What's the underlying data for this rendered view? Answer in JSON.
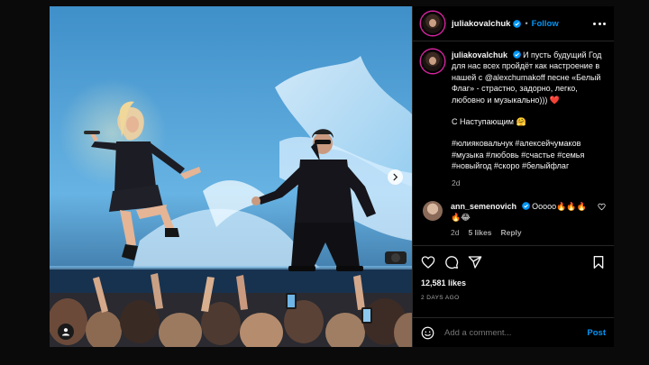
{
  "post": {
    "username": "juliakovalchuk",
    "follow_label": "Follow",
    "separator": "•",
    "caption": {
      "username": "juliakovalchuk",
      "text": "И пусть будущий Год для нас всех пройдёт как настроение в нашей с @alexchumakoff песне «Белый Флаг» - страстно, задорно, легко, любовно и музыкально)))",
      "text_emoji": "❤️",
      "greeting": "С Наступающим 🤗",
      "hashtags": "#юлияковальчук #алексейчумаков #музыка #любовь #счастье #семья #новыйгод #скоро #белыйфлаг",
      "time": "2d"
    },
    "comments": [
      {
        "username": "ann_semenovich",
        "text": "Ооооо🔥🔥🔥🔥😂",
        "time": "2d",
        "likes": "5 likes",
        "reply": "Reply"
      }
    ],
    "likes": "12,581 likes",
    "date": "2 DAYS AGO",
    "add_comment_placeholder": "Add a comment...",
    "post_label": "Post"
  },
  "colors": {
    "accent": "#0095f6",
    "background": "#000000",
    "border": "#262626",
    "muted": "#a8a8a8",
    "heart": "#ed4956"
  },
  "icons": [
    "chevron-right-icon",
    "user-tag-icon",
    "verified-badge-icon",
    "more-options-icon",
    "heart-icon",
    "comment-icon",
    "share-icon",
    "bookmark-icon",
    "emoji-icon"
  ]
}
